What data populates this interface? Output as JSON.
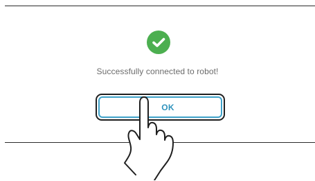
{
  "dialog": {
    "message": "Successfully connected to robot!",
    "ok_label": "OK",
    "icon": "check-circle-icon"
  },
  "overlay": {
    "icon": "tap-hand-icon"
  },
  "colors": {
    "success_green": "#4caf50",
    "button_blue": "#3ea1c8",
    "text_gray": "#6b6b6b"
  }
}
